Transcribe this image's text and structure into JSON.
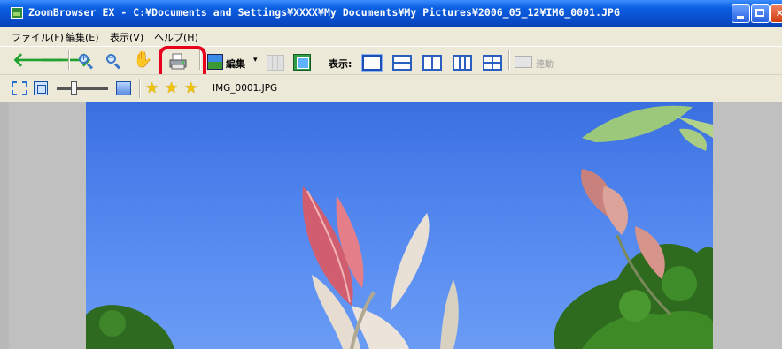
{
  "window": {
    "title": "ZoomBrowser EX - C:¥Documents and Settings¥XXXX¥My Documents¥My Pictures¥2006_05_12¥IMG_0001.JPG"
  },
  "menu": {
    "items": [
      "ファイル(F)",
      "編集(E)",
      "表示(V)",
      "ヘルプ(H)"
    ]
  },
  "toolbar": {
    "edit_label": "編集",
    "view_label": "表示:",
    "sync_label": "連動"
  },
  "toolbar2": {
    "filename": "IMG_0001.JPG"
  },
  "colors": {
    "highlight": "#e8001c",
    "title_bar": "#0a4fd0"
  },
  "icons": [
    "back-icon",
    "forward-icon",
    "zoom-in-icon",
    "zoom-out-icon",
    "hand-pan-icon",
    "print-icon",
    "image-edit-icon",
    "view-layout-icon",
    "star-icon"
  ]
}
